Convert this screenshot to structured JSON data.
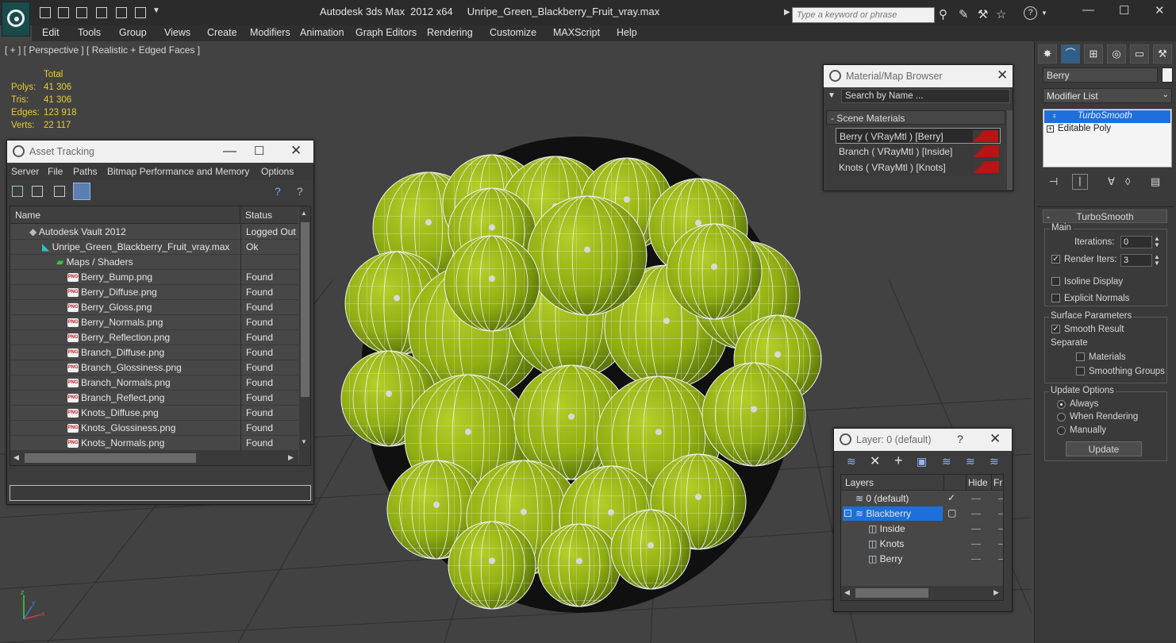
{
  "titlebar": {
    "title": "Autodesk 3ds Max  2012 x64     Unripe_Green_Blackberry_Fruit_vray.max",
    "search_placeholder": "Type a keyword or phrase",
    "help_label": "?"
  },
  "menu": [
    "Edit",
    "Tools",
    "Group",
    "Views",
    "Create",
    "Modifiers",
    "Animation",
    "Graph Editors",
    "Rendering",
    "Customize",
    "MAXScript",
    "Help"
  ],
  "viewport": {
    "label": "[ + ] [ Perspective ] [ Realistic + Edged Faces ]",
    "stats": {
      "header": "Total",
      "rows": [
        {
          "label": "Polys:",
          "value": "41 306"
        },
        {
          "label": "Tris:",
          "value": "41 306"
        },
        {
          "label": "Edges:",
          "value": "123 918"
        },
        {
          "label": "Verts:",
          "value": "22 117"
        }
      ]
    },
    "gizmo": {
      "x": "x",
      "y": "y",
      "z": "z"
    }
  },
  "asset_tracking": {
    "title": "Asset Tracking",
    "menu": [
      "Server",
      "File",
      "Paths",
      "Bitmap Performance and Memory",
      "Options"
    ],
    "columns": [
      "Name",
      "Status"
    ],
    "rows": [
      {
        "name": "Autodesk Vault 2012",
        "status": "Logged Out"
      },
      {
        "name": "Unripe_Green_Blackberry_Fruit_vray.max",
        "status": "Ok"
      },
      {
        "name": "Maps / Shaders",
        "status": ""
      },
      {
        "name": "Berry_Bump.png",
        "status": "Found"
      },
      {
        "name": "Berry_Diffuse.png",
        "status": "Found"
      },
      {
        "name": "Berry_Gloss.png",
        "status": "Found"
      },
      {
        "name": "Berry_Normals.png",
        "status": "Found"
      },
      {
        "name": "Berry_Reflection.png",
        "status": "Found"
      },
      {
        "name": "Branch_Diffuse.png",
        "status": "Found"
      },
      {
        "name": "Branch_Glossiness.png",
        "status": "Found"
      },
      {
        "name": "Branch_Normals.png",
        "status": "Found"
      },
      {
        "name": "Branch_Reflect.png",
        "status": "Found"
      },
      {
        "name": "Knots_Diffuse.png",
        "status": "Found"
      },
      {
        "name": "Knots_Glossiness.png",
        "status": "Found"
      },
      {
        "name": "Knots_Normals.png",
        "status": "Found"
      },
      {
        "name": "Knots_Reflect.png",
        "status": "Found"
      }
    ]
  },
  "material_browser": {
    "title": "Material/Map Browser",
    "search_placeholder": "Search by Name ...",
    "section": "- Scene Materials",
    "materials": [
      "Berry  ( VRayMtl )  [Berry]",
      "Branch  ( VRayMtl )  [Inside]",
      "Knots  ( VRayMtl )  [Knots]"
    ]
  },
  "layer_window": {
    "title": "Layer: 0 (default)",
    "help": "?",
    "columns": [
      "Layers",
      "Hide",
      "Fr"
    ],
    "rows": [
      {
        "name": "0 (default)",
        "level": 0
      },
      {
        "name": "Blackberry",
        "level": 0
      },
      {
        "name": "Inside",
        "level": 1
      },
      {
        "name": "Knots",
        "level": 1
      },
      {
        "name": "Berry",
        "level": 1
      }
    ]
  },
  "command_panel": {
    "object_name": "Berry",
    "modifier_list": "Modifier List",
    "stack": [
      "TurboSmooth",
      "Editable Poly"
    ],
    "rollout_title": "TurboSmooth",
    "main_label": "Main",
    "iterations_label": "Iterations:",
    "iterations_value": "0",
    "render_iters_label": "Render Iters:",
    "render_iters_value": "3",
    "isoline_label": "Isoline Display",
    "explicit_normals_label": "Explicit Normals",
    "surface_label": "Surface Parameters",
    "smooth_result_label": "Smooth Result",
    "separate_label": "Separate",
    "materials_label": "Materials",
    "smoothing_groups_label": "Smoothing Groups",
    "update_options_label": "Update Options",
    "always_label": "Always",
    "when_rendering_label": "When Rendering",
    "manually_label": "Manually",
    "update_button": "Update"
  },
  "colors": {
    "berry": "#8fae12",
    "wire": "#f2f2f2",
    "selection": "#1e6fd9",
    "stats": "#e6cc3a"
  }
}
